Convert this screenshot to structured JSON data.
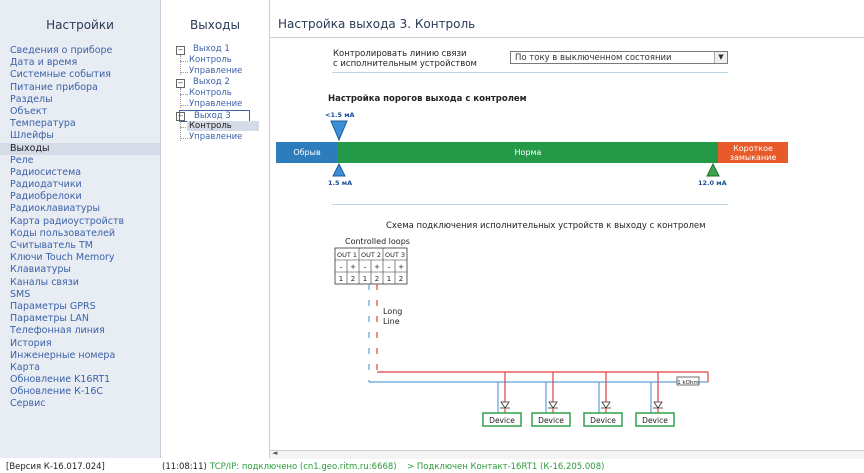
{
  "settings_panel": {
    "title": "Настройки",
    "items": [
      "Сведения о приборе",
      "Дата и время",
      "Системные события",
      "Питание прибора",
      "Разделы",
      "Объект",
      "Температура",
      "Шлейфы",
      "Выходы",
      "Реле",
      "Радиосистема",
      "Радиодатчики",
      "Радиобрелоки",
      "Радиоклавиатуры",
      "Карта радиоустройств",
      "Коды пользователей",
      "Считыватель ТМ",
      "Ключи Touch Memory",
      "Клавиатуры",
      "Каналы связи",
      "SMS",
      "Параметры GPRS",
      "Параметры LAN",
      "Телефонная линия",
      "История",
      "Инженерные номера",
      "Карта",
      "Обновление K16RT1",
      "Обновление К-16С",
      "Сервис"
    ],
    "selected_index": 8
  },
  "outputs_panel": {
    "title": "Выходы",
    "tree": [
      {
        "label": "Выход 1",
        "children": [
          "Контроль",
          "Управление"
        ]
      },
      {
        "label": "Выход 2",
        "children": [
          "Контроль",
          "Управление"
        ]
      },
      {
        "label": "Выход 3",
        "children": [
          "Контроль",
          "Управление"
        ]
      }
    ],
    "selected": "Выход 3 / Контроль"
  },
  "main": {
    "title": "Настройка выхода 3. Контроль",
    "control_label_line1": "Контролировать линию связи",
    "control_label_line2": "с исполнительным устройством",
    "control_value": "По току в выключенном состоянии",
    "thresholds_title": "Настройка порогов выхода с контролем",
    "top_marker": "<1.5 мА",
    "zones": {
      "break": "Обрыв",
      "norm": "Норма",
      "short_line1": "Короткое",
      "short_line2": "замыкание"
    },
    "bottom_marker_left": "1.5 мА",
    "bottom_marker_right": "12.0 мА",
    "scheme_title": "Схема подключения исполнительных устройств к выходу с контролем",
    "diagram": {
      "loops_title": "Controlled loops",
      "outputs": [
        "OUT 1",
        "OUT 2",
        "OUT 3"
      ],
      "signs": [
        "–",
        "+",
        "–",
        "+",
        "–",
        "+"
      ],
      "pins": [
        "1",
        "2",
        "1",
        "2",
        "1",
        "2"
      ],
      "long_line1": "Long",
      "long_line2": "Line",
      "resistor": "1 kOhm",
      "device": "Device"
    }
  },
  "status": {
    "version": "[Версия К-16.017.024]",
    "time": "(11:08:11)",
    "tcp": "TCP/IP: подключено (cn1.geo.ritm.ru:6668)",
    "connected": "> Подключен Контакт-16RT1 (К-16.205.008)"
  },
  "colors": {
    "break": "#2d7dbd",
    "norm": "#249a49",
    "short": "#e85a2a",
    "link": "#3c62a8"
  }
}
